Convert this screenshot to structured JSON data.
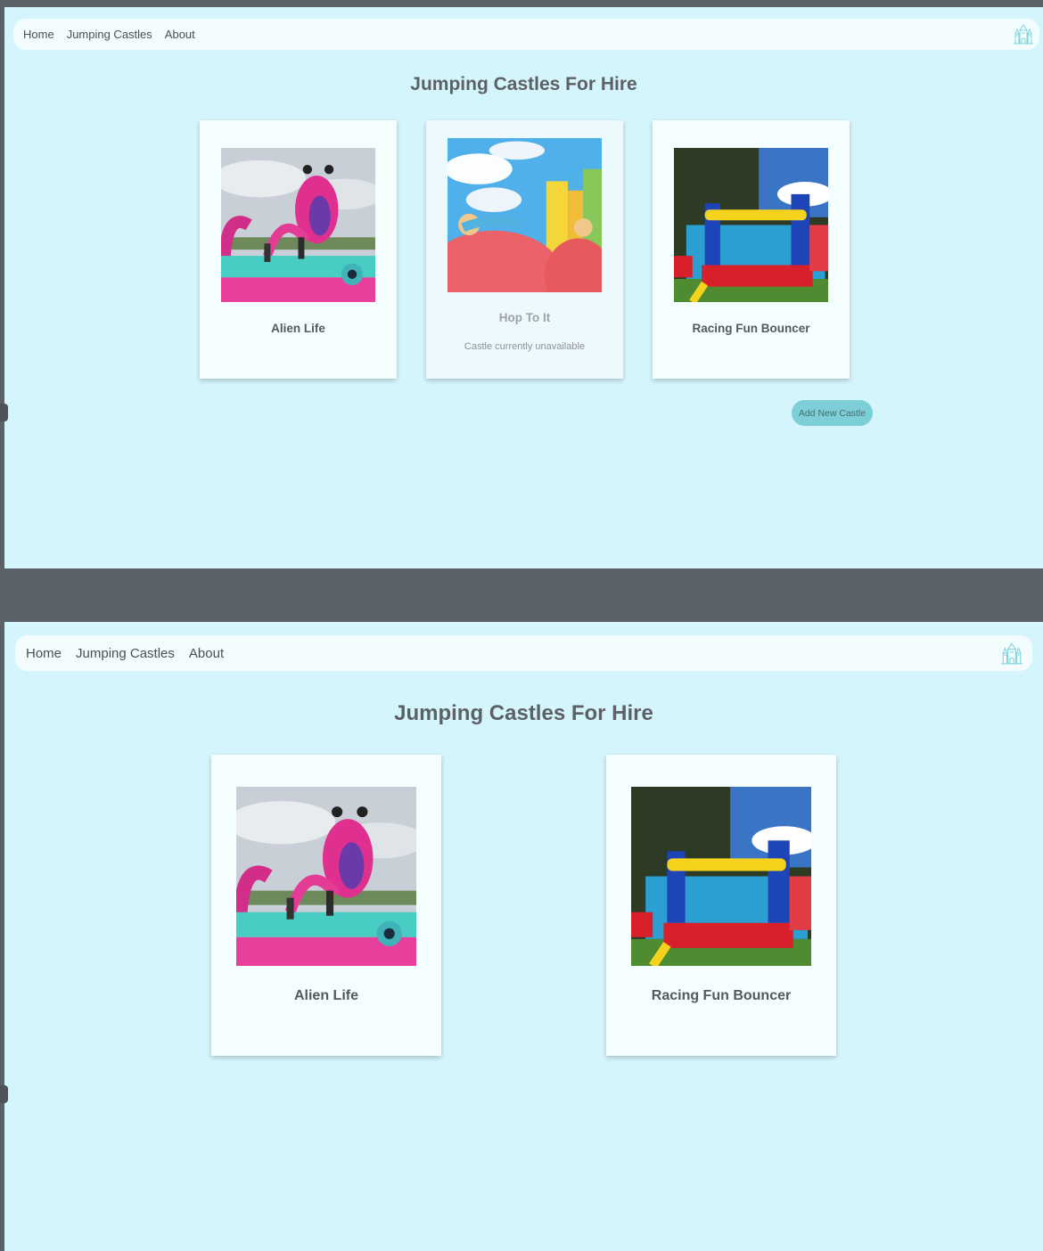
{
  "nav": {
    "links": [
      "Home",
      "Jumping Castles",
      "About"
    ]
  },
  "page": {
    "title": "Jumping Castles For Hire"
  },
  "castles": [
    {
      "name": "Alien Life",
      "available": true
    },
    {
      "name": "Hop To It",
      "available": false,
      "note": "Castle currently unavailable"
    },
    {
      "name": "Racing Fun Bouncer",
      "available": true
    }
  ],
  "actions": {
    "add_castle_label": "Add New Castle"
  },
  "icons": {
    "logo": "castle-icon"
  },
  "colors": {
    "background": "#d4f5fc",
    "card": "#f5fefe",
    "accent_button": "#7ccfd6",
    "logo": "#7fd2dc",
    "divider": "#5b6168"
  }
}
